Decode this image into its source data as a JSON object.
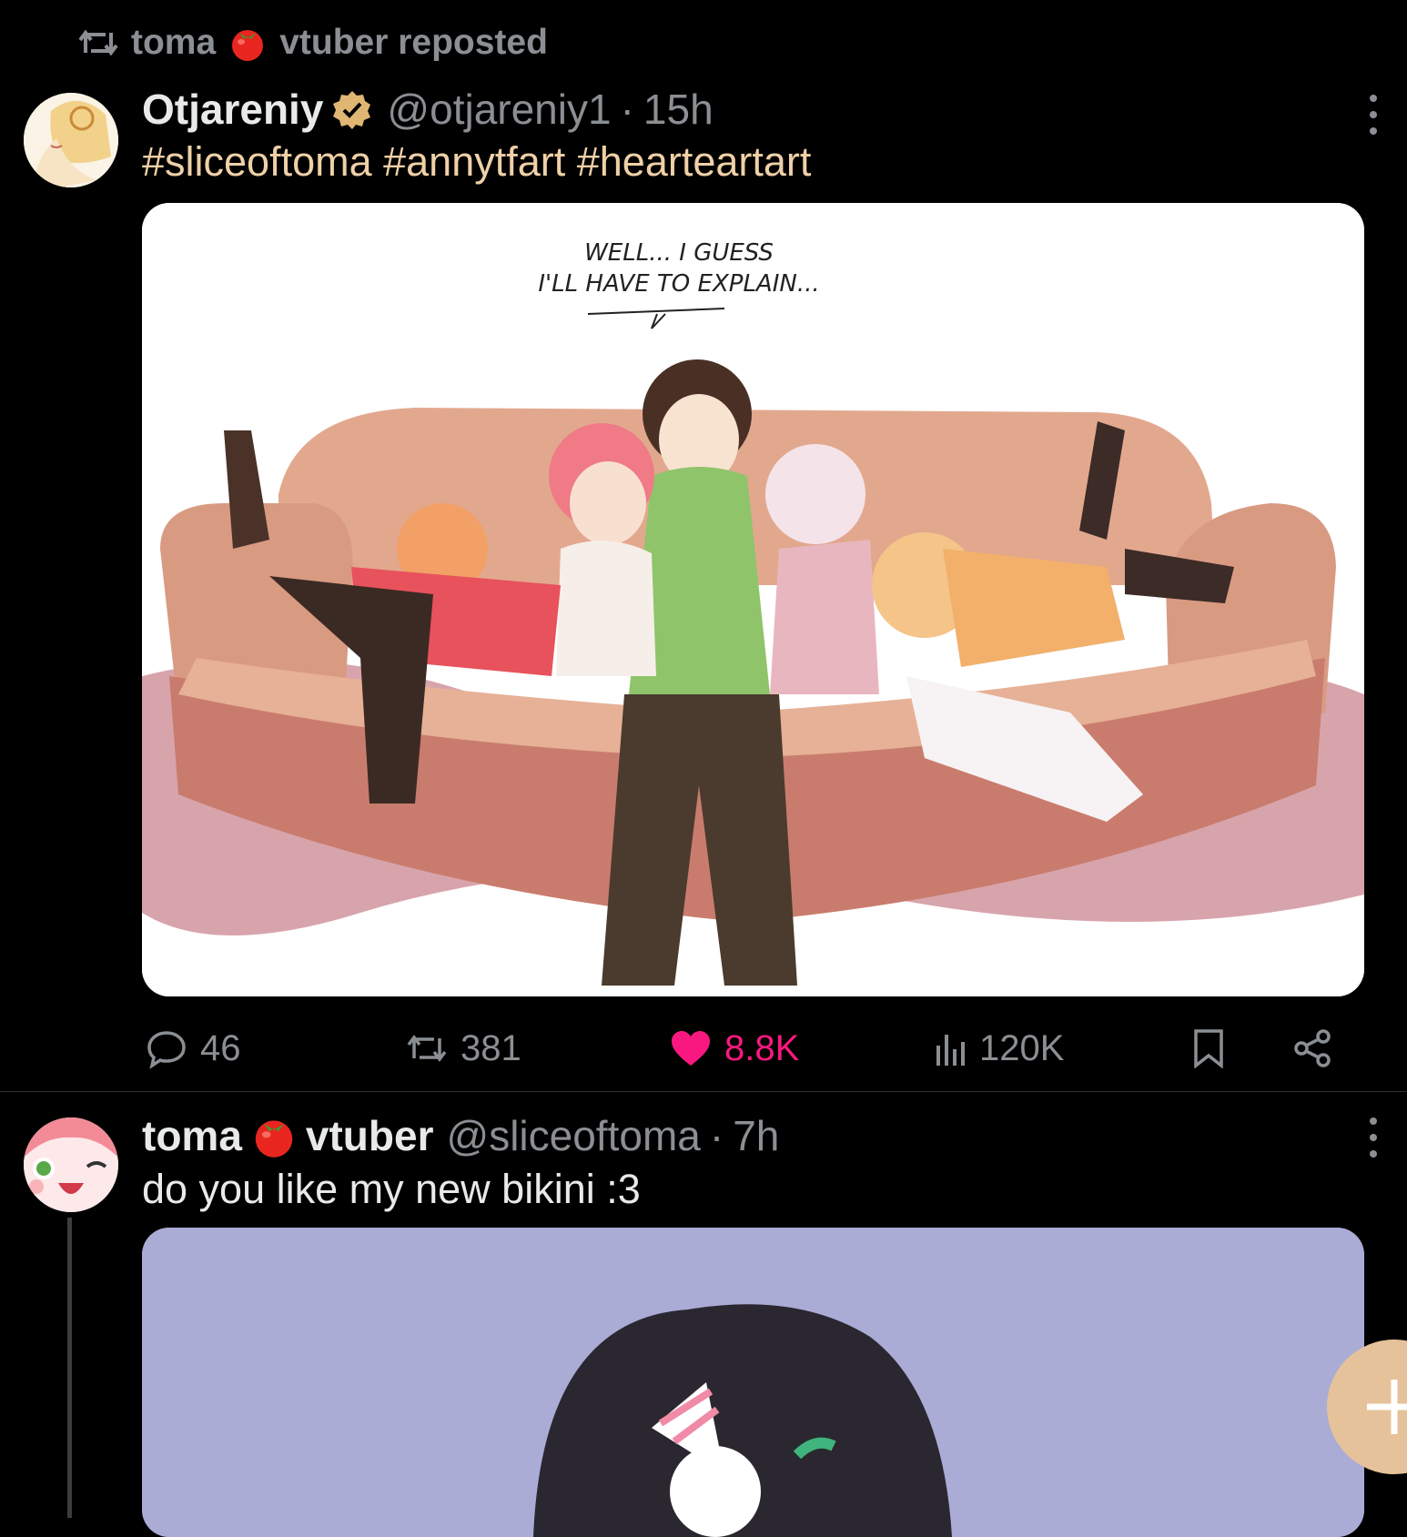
{
  "repost": {
    "icon": "repost-icon",
    "name_part1": "toma",
    "name_part2": "vtuber reposted"
  },
  "post1": {
    "display_name": "Otjareniy",
    "verified": true,
    "handle": "@otjareniy1",
    "separator": "·",
    "time": "15h",
    "text": "#sliceoftoma #annytfart #hearteartart",
    "image_caption": "WELL... I GUESS\nI'LL HAVE TO EXPLAIN...",
    "actions": {
      "replies": "46",
      "reposts": "381",
      "likes": "8.8K",
      "views": "120K"
    },
    "like_color": "#f91880"
  },
  "post2": {
    "display_name_part1": "toma",
    "display_name_part2": "vtuber",
    "handle": "@sliceoftoma",
    "separator": "·",
    "time": "7h",
    "text": "do you like my new bikini :3"
  },
  "fab": {
    "icon": "plus-icon",
    "color": "#e6c29a"
  },
  "colors": {
    "background": "#000000",
    "muted": "#8b8f93",
    "hashtag": "#efd0a7",
    "verified_badge": "#e0b673"
  }
}
